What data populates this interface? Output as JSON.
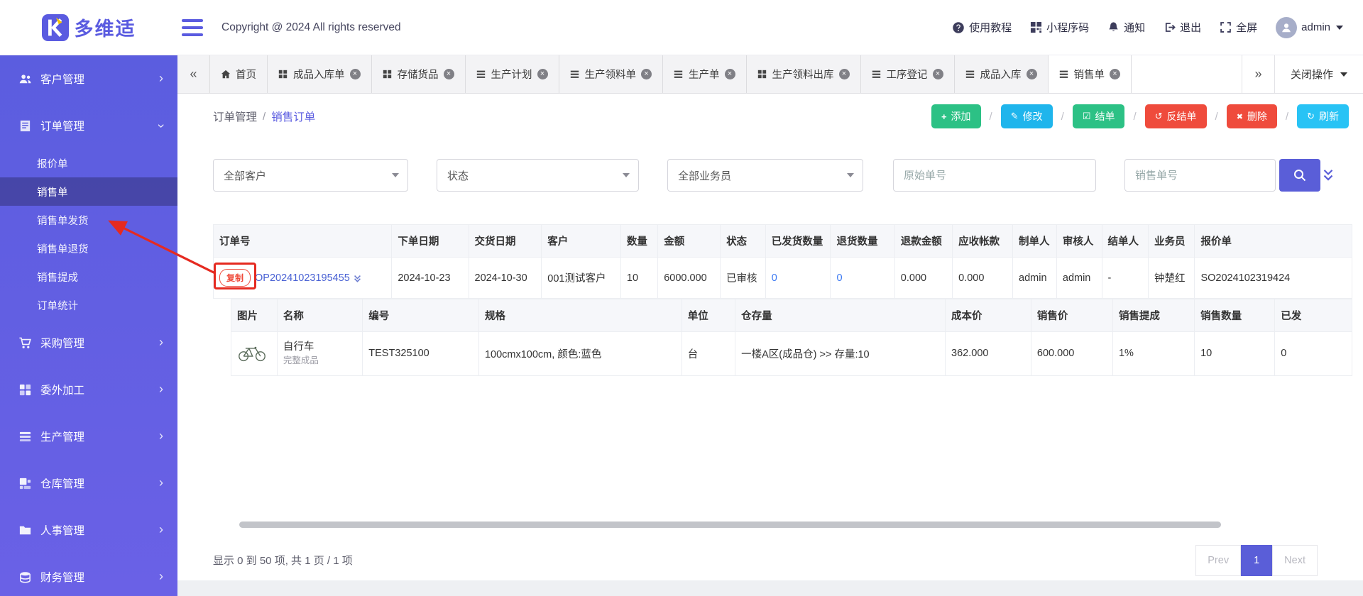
{
  "topbar": {
    "logo_text": "多维适",
    "copyright": "Copyright @ 2024 All rights reserved",
    "menu": [
      {
        "icon": "help-circle-icon",
        "label": "使用教程"
      },
      {
        "icon": "qr-code-icon",
        "label": "小程序码"
      },
      {
        "icon": "bell-icon",
        "label": "通知"
      },
      {
        "icon": "logout-icon",
        "label": "退出"
      },
      {
        "icon": "fullscreen-icon",
        "label": "全屏"
      },
      {
        "icon": "avatar",
        "label": "admin"
      }
    ]
  },
  "sidebar": {
    "items": [
      {
        "icon": "users-icon",
        "label": "客户管理"
      },
      {
        "icon": "orders-icon",
        "label": "订单管理"
      },
      {
        "icon": "cart-icon",
        "label": "采购管理"
      },
      {
        "icon": "outsource-icon",
        "label": "委外加工"
      },
      {
        "icon": "production-icon",
        "label": "生产管理"
      },
      {
        "icon": "warehouse-icon",
        "label": "仓库管理"
      },
      {
        "icon": "hr-icon",
        "label": "人事管理"
      },
      {
        "icon": "finance-icon",
        "label": "财务管理"
      }
    ],
    "order_children": [
      {
        "label": "报价单"
      },
      {
        "label": "销售单"
      },
      {
        "label": "销售单发货"
      },
      {
        "label": "销售单退货"
      },
      {
        "label": "销售提成"
      },
      {
        "label": "订单统计"
      }
    ]
  },
  "tabbar": {
    "tabs": [
      {
        "icon": "home-icon",
        "label": "首页"
      },
      {
        "icon": "grid-icon",
        "label": "成品入库单"
      },
      {
        "icon": "grid-icon",
        "label": "存储货品"
      },
      {
        "icon": "list-icon",
        "label": "生产计划"
      },
      {
        "icon": "list-icon",
        "label": "生产领料单"
      },
      {
        "icon": "list-icon",
        "label": "生产单"
      },
      {
        "icon": "grid-icon",
        "label": "生产领料出库"
      },
      {
        "icon": "list-icon",
        "label": "工序登记"
      },
      {
        "icon": "list-icon",
        "label": "成品入库"
      },
      {
        "icon": "list-icon",
        "label": "销售单"
      }
    ],
    "close_menu": "关闭操作"
  },
  "breadcrumb": {
    "parent": "订单管理",
    "sep": "/",
    "current": "销售订单"
  },
  "toolbar": {
    "sep": "/",
    "add": "添加",
    "edit": "修改",
    "close_order": "结单",
    "reopen": "反结单",
    "delete": "删除",
    "refresh": "刷新"
  },
  "filters": {
    "customer": "全部客户",
    "status": "状态",
    "salesman": "全部业务员",
    "original_no_placeholder": "原始单号",
    "sales_no_placeholder": "销售单号"
  },
  "orders_table": {
    "headers": [
      "订单号",
      "下单日期",
      "交货日期",
      "客户",
      "数量",
      "金额",
      "状态",
      "已发货数量",
      "退货数量",
      "退款金额",
      "应收帐款",
      "制单人",
      "审核人",
      "结单人",
      "业务员",
      "报价单"
    ],
    "row": {
      "copy": "复制",
      "order_no": "OP20241023195455",
      "order_date": "2024-10-23",
      "delivery_date": "2024-10-30",
      "customer": "001测试客户",
      "qty": "10",
      "amount": "6000.000",
      "status": "已审核",
      "shipped_qty": "0",
      "return_qty": "0",
      "refund_amount": "0.000",
      "receivable": "0.000",
      "maker": "admin",
      "auditor": "admin",
      "closer": "-",
      "salesman": "钟楚红",
      "quotation": "SO2024102319424"
    }
  },
  "detail_table": {
    "headers": [
      "图片",
      "名称",
      "编号",
      "规格",
      "单位",
      "仓存量",
      "成本价",
      "销售价",
      "销售提成",
      "销售数量",
      "已发"
    ],
    "row": {
      "name": "自行车",
      "name_sub": "完整成品",
      "code": "TEST325100",
      "spec": "100cmx100cm, 颜色:蓝色",
      "unit": "台",
      "stock": "一楼A区(成品仓) >> 存量:10",
      "cost_price": "362.000",
      "sale_price": "600.000",
      "commission": "1%",
      "sale_qty": "10",
      "shipped": "0"
    }
  },
  "footer": {
    "summary": "显示 0 到 50 项, 共 1 页 / 1 项",
    "prev": "Prev",
    "page": "1",
    "next": "Next"
  },
  "colors": {
    "sidebar": "#5b5ddf",
    "accent": "#5a5ed8",
    "green": "#2cc185",
    "blue": "#1fb5ec",
    "red": "#ef4b3c",
    "cyan": "#28c3f5",
    "link": "#4a62d4",
    "annotation": "#e52a20"
  }
}
